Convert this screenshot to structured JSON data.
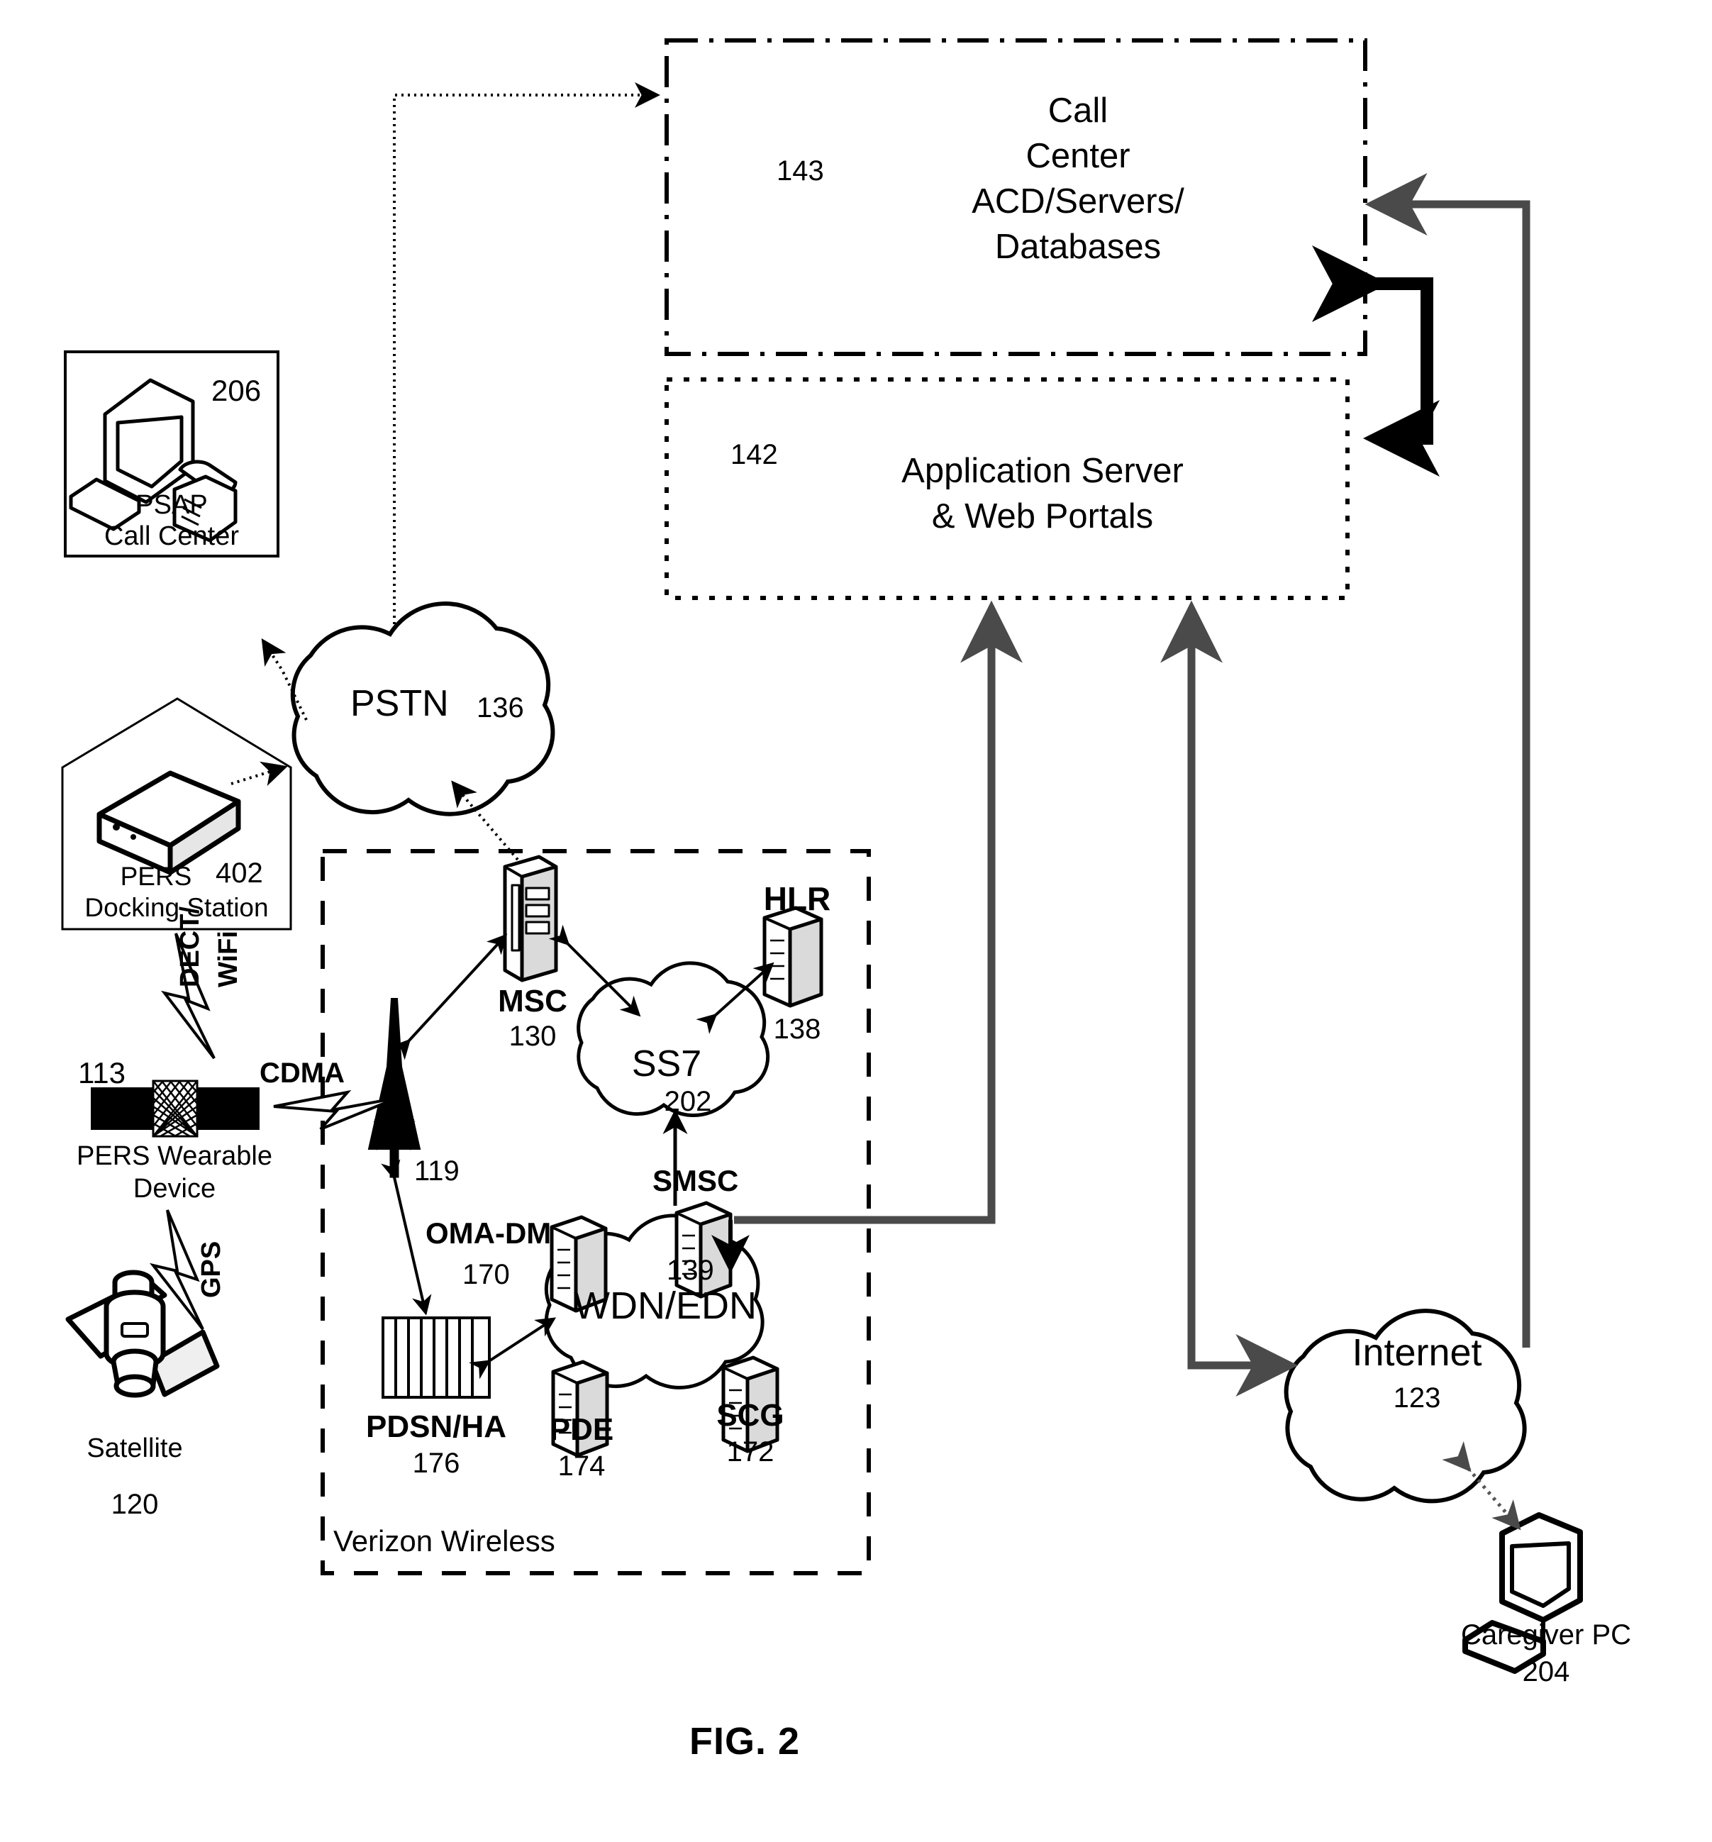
{
  "figure": {
    "caption": "FIG. 2"
  },
  "nodes": {
    "call_center": {
      "ref": "143",
      "line1": "Call",
      "line2": "Center",
      "line3": "ACD/Servers/",
      "line4": "Databases",
      "border": "dash-dot"
    },
    "app_server": {
      "ref": "142",
      "line1": "Application Server",
      "line2": "& Web Portals",
      "border": "dotted"
    },
    "psap": {
      "ref": "206",
      "line1": "PSAP",
      "line2": "Call Center",
      "icon": "desktop-computer-and-telephone-icon"
    },
    "pstn": {
      "label": "PSTN",
      "ref": "136",
      "shape": "cloud"
    },
    "docking_station": {
      "line1": "PERS",
      "line2": "Docking Station",
      "ref": "402",
      "icon": "docking-station-icon",
      "outline": "house"
    },
    "wearable": {
      "ref": "113",
      "line1": "PERS Wearable",
      "line2": "Device",
      "icon": "wearable-band-icon"
    },
    "satellite": {
      "label": "Satellite",
      "ref": "120",
      "icon": "satellite-icon"
    },
    "tower": {
      "ref": "119",
      "icon": "cell-tower-icon"
    },
    "msc": {
      "label": "MSC",
      "ref": "130",
      "icon": "server-rack-icon"
    },
    "hlr": {
      "label": "HLR",
      "ref": "138",
      "icon": "database-server-icon"
    },
    "ss7": {
      "label": "SS7",
      "ref": "202",
      "shape": "cloud"
    },
    "smsc": {
      "label": "SMSC",
      "ref": "139",
      "icon": "server-icon"
    },
    "oma_dm": {
      "label": "OMA-DM",
      "ref": "170",
      "icon": "server-icon"
    },
    "wdn_edn": {
      "label": "WDN/EDN",
      "shape": "cloud"
    },
    "pdsn_ha": {
      "label": "PDSN/HA",
      "ref": "176",
      "icon": "router-stack-icon"
    },
    "pde": {
      "label": "PDE",
      "ref": "174",
      "icon": "server-icon"
    },
    "scg": {
      "label": "SCG",
      "ref": "172",
      "icon": "server-icon"
    },
    "verizon": {
      "label": "Verizon Wireless",
      "border": "dashed"
    },
    "internet": {
      "label": "Internet",
      "ref": "123",
      "shape": "cloud"
    },
    "caregiver_pc": {
      "line1": "Caregiver PC",
      "ref": "204",
      "icon": "desktop-computer-icon"
    }
  },
  "link_labels": {
    "dect_wifi_line1": "DECT/",
    "dect_wifi_line2": "WiFi",
    "gps": "GPS",
    "cdma": "CDMA"
  },
  "colors": {
    "ink": "#000000",
    "paper": "#ffffff",
    "hatched_line": "#555555"
  }
}
